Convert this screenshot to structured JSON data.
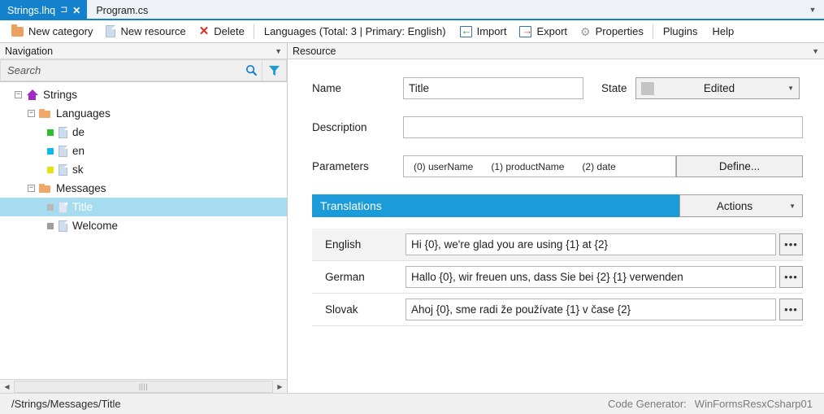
{
  "tabs": [
    {
      "label": "Strings.lhq",
      "active": true,
      "pin_icon": "pin-icon",
      "close_icon": "close-icon"
    },
    {
      "label": "Program.cs",
      "active": false
    }
  ],
  "tabbar": {
    "overflow_icon": "chevron-down-icon"
  },
  "toolbar": {
    "new_category": "New category",
    "new_resource": "New resource",
    "delete": "Delete",
    "languages_info": "Languages (Total: 3 | Primary: English)",
    "import": "Import",
    "export": "Export",
    "properties": "Properties",
    "plugins": "Plugins",
    "help": "Help"
  },
  "navigation": {
    "title": "Navigation",
    "search": {
      "placeholder": "Search",
      "value": ""
    },
    "tree": [
      {
        "label": "Strings",
        "depth": 0,
        "icon": "home-icon",
        "expander": "minus",
        "square": null
      },
      {
        "label": "Languages",
        "depth": 1,
        "icon": "open-folder-icon",
        "expander": "minus",
        "square": null
      },
      {
        "label": "de",
        "depth": 2,
        "icon": "document-icon",
        "expander": null,
        "square": "#2cc02c"
      },
      {
        "label": "en",
        "depth": 2,
        "icon": "document-icon",
        "expander": null,
        "square": "#13b7e8"
      },
      {
        "label": "sk",
        "depth": 2,
        "icon": "document-icon",
        "expander": null,
        "square": "#e8e012"
      },
      {
        "label": "Messages",
        "depth": 1,
        "icon": "open-folder-icon",
        "expander": "minus",
        "square": null
      },
      {
        "label": "Title",
        "depth": 2,
        "icon": "document-icon",
        "expander": null,
        "square": "#b9b9b9",
        "selected": true
      },
      {
        "label": "Welcome",
        "depth": 2,
        "icon": "document-icon",
        "expander": null,
        "square": "#9e9e9e"
      }
    ],
    "scrollbar": {
      "left_icon": "arrow-left-icon",
      "right_icon": "arrow-right-icon",
      "grip": "||||"
    }
  },
  "resource": {
    "title": "Resource",
    "name_label": "Name",
    "name_value": "Title",
    "state_label": "State",
    "state_value": "Edited",
    "state_color": "#c4c4c4",
    "description_label": "Description",
    "description_value": "",
    "parameters_label": "Parameters",
    "parameters": [
      "(0) userName",
      "(1) productName",
      "(2) date"
    ],
    "define_button": "Define...",
    "translations_title": "Translations",
    "actions_button": "Actions",
    "translations": [
      {
        "language": "English",
        "text": "Hi {0}, we're glad you are using {1} at {2}",
        "menu_icon": "ellipsis-icon"
      },
      {
        "language": "German",
        "text": "Hallo {0}, wir freuen uns, dass Sie bei {2} {1} verwenden",
        "menu_icon": "ellipsis-icon"
      },
      {
        "language": "Slovak",
        "text": "Ahoj {0}, sme radi že používate {1} v čase {2}",
        "menu_icon": "ellipsis-icon"
      }
    ]
  },
  "statusbar": {
    "path": "/Strings/Messages/Title",
    "generator_label": "Code Generator:",
    "generator_value": "WinFormsResxCsharp01"
  },
  "colors": {
    "accent": "#1481cc",
    "translations_header": "#1b9cd8",
    "selection": "#a5dcf0"
  }
}
